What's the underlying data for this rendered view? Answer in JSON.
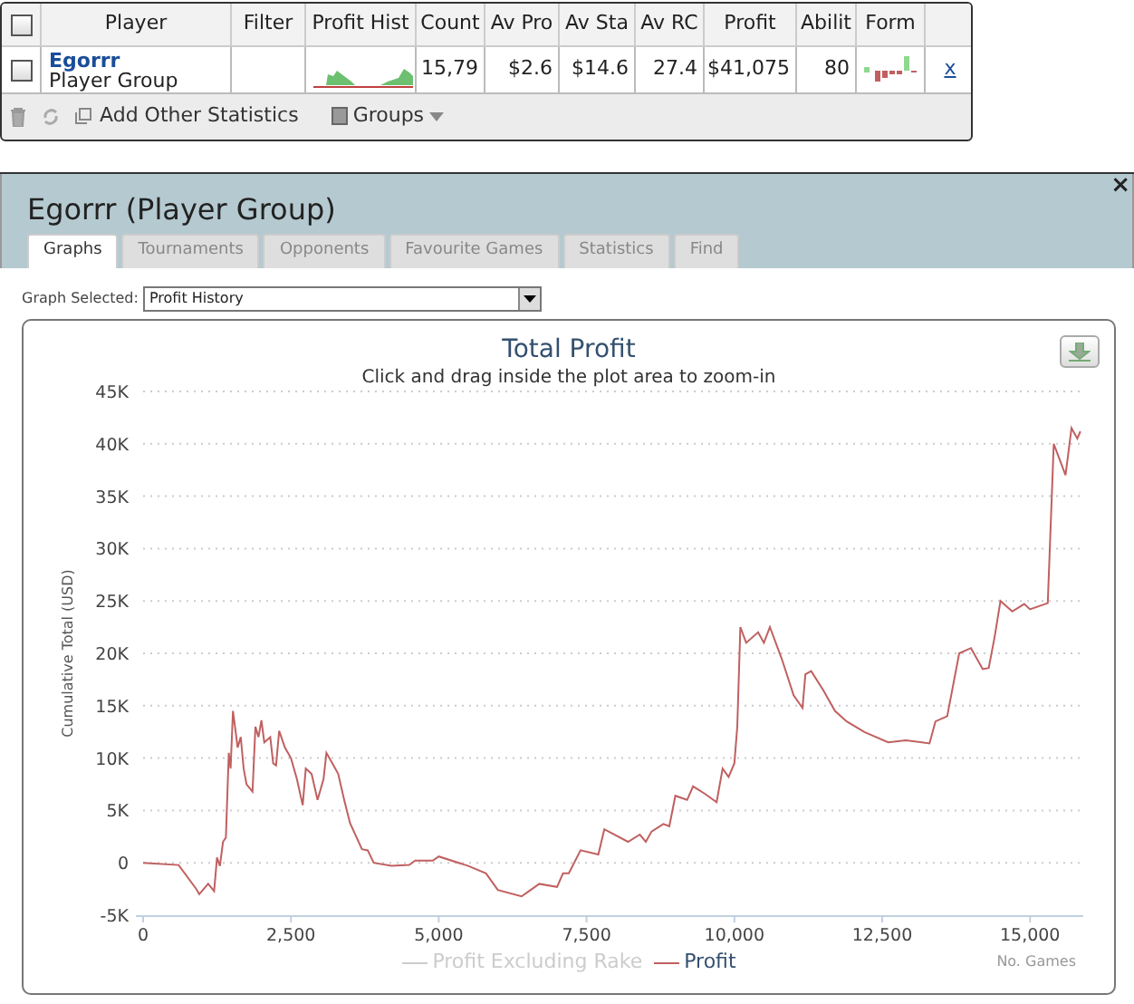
{
  "stats_table": {
    "header_checkbox": {
      "checked": false
    },
    "columns": [
      "Player",
      "Filter",
      "Profit Hist",
      "Count",
      "Av Pro",
      "Av Sta",
      "Av RC",
      "Profit",
      "Abilit",
      "Form"
    ],
    "rows": [
      {
        "checked": false,
        "player": "Egorrr",
        "player_type": "Player Group",
        "count": "15,79",
        "av_pro": "$2.6",
        "av_sta": "$14.6",
        "av_rc": "27.4",
        "profit": "$41,075",
        "ability": "80",
        "remove": "x"
      }
    ],
    "toolbar": {
      "add_label": "Add Other Statistics",
      "groups_label": "Groups"
    }
  },
  "panel": {
    "title": "Egorrr (Player Group)",
    "close": "×",
    "tabs": [
      {
        "label": "Graphs",
        "selected": true
      },
      {
        "label": "Tournaments",
        "selected": false
      },
      {
        "label": "Opponents",
        "selected": false
      },
      {
        "label": "Favourite Games",
        "selected": false
      },
      {
        "label": "Statistics",
        "selected": false
      },
      {
        "label": "Find",
        "selected": false
      }
    ],
    "graph_select": {
      "label": "Graph Selected:",
      "value": "Profit History"
    },
    "legend": [
      {
        "label": "Profit Excluding Rake",
        "hidden": true
      }
    ],
    "chart_data": {
      "type": "line",
      "title": "Total Profit",
      "subtitle": "Click and drag inside the plot area to zoom-in",
      "xlabel": "No. Games",
      "ylabel": "Cumulative Total (USD)",
      "grid": true,
      "xlim": [
        0,
        15900
      ],
      "ylim": [
        -5000,
        45000
      ],
      "xticks": [
        {
          "value": 0,
          "label": "0"
        },
        {
          "value": 2500,
          "label": "2,500"
        },
        {
          "value": 5000,
          "label": "5,000"
        },
        {
          "value": 7500,
          "label": "7,500"
        },
        {
          "value": 10000,
          "label": "10,000"
        },
        {
          "value": 12500,
          "label": "12,500"
        },
        {
          "value": 15000,
          "label": "15,000"
        }
      ],
      "yticks": [
        {
          "value": -5000,
          "label": "-5K"
        },
        {
          "value": 0,
          "label": "0"
        },
        {
          "value": 5000,
          "label": "5K"
        },
        {
          "value": 10000,
          "label": "10K"
        },
        {
          "value": 15000,
          "label": "15K"
        },
        {
          "value": 20000,
          "label": "20K"
        },
        {
          "value": 25000,
          "label": "25K"
        },
        {
          "value": 30000,
          "label": "30K"
        },
        {
          "value": 35000,
          "label": "35K"
        },
        {
          "value": 40000,
          "label": "40K"
        },
        {
          "value": 45000,
          "label": "45K"
        }
      ],
      "x": [
        0,
        600,
        900,
        950,
        1100,
        1200,
        1250,
        1300,
        1350,
        1400,
        1450,
        1480,
        1520,
        1600,
        1650,
        1700,
        1750,
        1850,
        1900,
        1950,
        2000,
        2050,
        2150,
        2200,
        2250,
        2300,
        2400,
        2500,
        2600,
        2700,
        2750,
        2850,
        2950,
        3050,
        3100,
        3200,
        3300,
        3400,
        3500,
        3700,
        3800,
        3900,
        4200,
        4500,
        4600,
        4900,
        5000,
        5500,
        5800,
        6000,
        6400,
        6500,
        6700,
        7000,
        7100,
        7200,
        7400,
        7700,
        7800,
        8200,
        8400,
        8500,
        8600,
        8800,
        8900,
        9000,
        9200,
        9300,
        9500,
        9700,
        9800,
        9900,
        10000,
        10050,
        10100,
        10200,
        10400,
        10500,
        10600,
        10800,
        11000,
        11150,
        11200,
        11300,
        11500,
        11700,
        11900,
        12200,
        12600,
        12900,
        13300,
        13400,
        13600,
        13800,
        14000,
        14200,
        14300,
        14400,
        14500,
        14700,
        14900,
        15000,
        15300,
        15400,
        15600,
        15700,
        15800,
        15850
      ],
      "series": [
        {
          "name": "Profit",
          "color": "#c06060",
          "values": [
            0,
            -200,
            -2500,
            -3000,
            -2000,
            -2700,
            500,
            -300,
            2000,
            2400,
            10500,
            9000,
            14500,
            11000,
            12000,
            9000,
            7500,
            6800,
            13000,
            12000,
            13600,
            11500,
            12000,
            9500,
            9300,
            12600,
            11000,
            10000,
            8000,
            5500,
            9000,
            8500,
            6000,
            8000,
            10500,
            9500,
            8500,
            6000,
            3800,
            1300,
            1200,
            0,
            -300,
            -200,
            200,
            200,
            600,
            -300,
            -1000,
            -2600,
            -3200,
            -2800,
            -2000,
            -2300,
            -1000,
            -1000,
            1200,
            800,
            3200,
            2000,
            2700,
            2000,
            3000,
            3700,
            3500,
            6400,
            6000,
            7300,
            6600,
            5800,
            9000,
            8200,
            9500,
            13000,
            22500,
            21000,
            22000,
            21000,
            22500,
            19500,
            16000,
            14800,
            18000,
            18300,
            16500,
            14500,
            13500,
            12500,
            11500,
            11700,
            11400,
            13500,
            14000,
            20000,
            20500,
            18500,
            18600,
            21500,
            25000,
            24000,
            24700,
            24200,
            24800,
            40000,
            37000,
            41500,
            40500,
            41200
          ]
        }
      ]
    }
  }
}
